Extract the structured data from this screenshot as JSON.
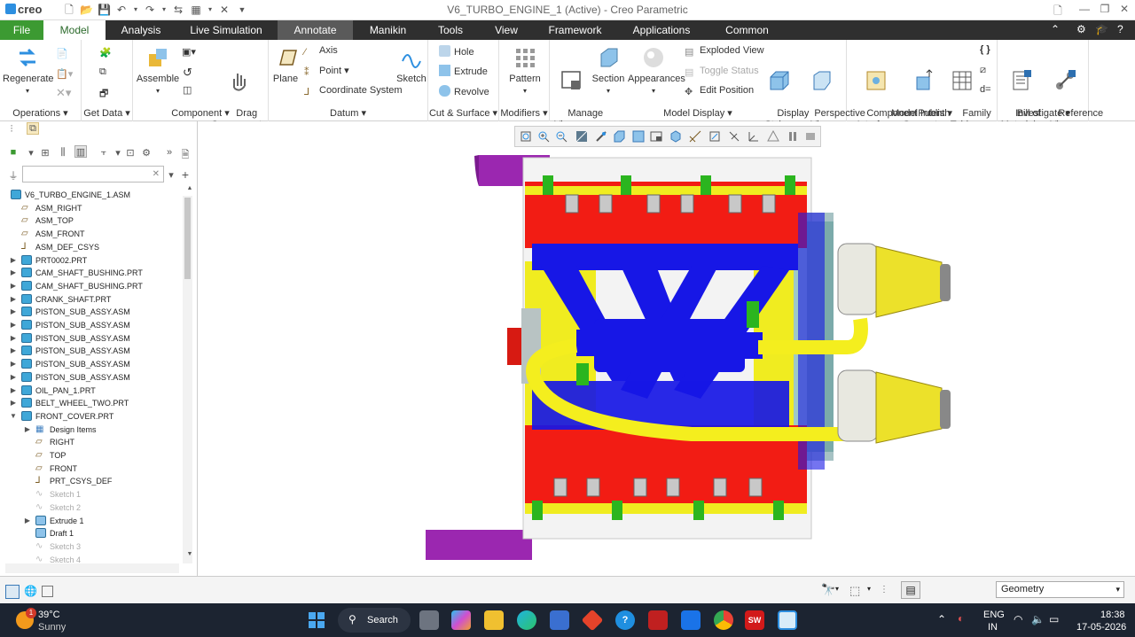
{
  "app": {
    "logo": "creo",
    "title": "V6_TURBO_ENGINE_1 (Active) - Creo Parametric"
  },
  "tabs": [
    "File",
    "Model",
    "Analysis",
    "Live Simulation",
    "Annotate",
    "Manikin",
    "Tools",
    "View",
    "Framework",
    "Applications",
    "Common"
  ],
  "ribbon": {
    "operations": {
      "regenerate": "Regenerate",
      "label": "Operations"
    },
    "get_data": {
      "label": "Get Data"
    },
    "component": {
      "assemble": "Assemble",
      "drag": "Drag\nComponents",
      "label": "Component"
    },
    "datum": {
      "plane": "Plane",
      "axis": "Axis",
      "point": "Point",
      "csys": "Coordinate System",
      "sketch": "Sketch",
      "label": "Datum"
    },
    "cut_surface": {
      "hole": "Hole",
      "extrude": "Extrude",
      "revolve": "Revolve",
      "label": "Cut & Surface"
    },
    "modifiers": {
      "pattern": "Pattern",
      "label": "Modifiers"
    },
    "model_display": {
      "manage_views": "Manage\nViews",
      "section": "Section",
      "appearances": "Appearances",
      "exploded": "Exploded View",
      "toggle": "Toggle Status",
      "edit_position": "Edit Position",
      "display_style": "Display\nStyle",
      "perspective": "Perspective\nView",
      "label": "Model Display"
    },
    "model_intent": {
      "component_interface": "Component\nInterface",
      "publish": "Publish\nGeometry",
      "family": "Family\nTable",
      "label": "Model Intent"
    },
    "investigate": {
      "bom": "Bill of\nMaterials",
      "reference": "Reference\nViewer",
      "label": "Investigate"
    }
  },
  "tree": [
    {
      "label": "V6_TURBO_ENGINE_1.ASM",
      "level": 0,
      "icon": "asm",
      "toggle": ""
    },
    {
      "label": "ASM_RIGHT",
      "level": 1,
      "icon": "plane",
      "toggle": ""
    },
    {
      "label": "ASM_TOP",
      "level": 1,
      "icon": "plane",
      "toggle": ""
    },
    {
      "label": "ASM_FRONT",
      "level": 1,
      "icon": "plane",
      "toggle": ""
    },
    {
      "label": "ASM_DEF_CSYS",
      "level": 1,
      "icon": "csys",
      "toggle": ""
    },
    {
      "label": "PRT0002.PRT",
      "level": 1,
      "icon": "part",
      "toggle": "▶"
    },
    {
      "label": "CAM_SHAFT_BUSHING.PRT",
      "level": 1,
      "icon": "part",
      "toggle": "▶"
    },
    {
      "label": "CAM_SHAFT_BUSHING.PRT",
      "level": 1,
      "icon": "part",
      "toggle": "▶"
    },
    {
      "label": "CRANK_SHAFT.PRT",
      "level": 1,
      "icon": "part",
      "toggle": "▶"
    },
    {
      "label": "PISTON_SUB_ASSY.ASM",
      "level": 1,
      "icon": "asm",
      "toggle": "▶"
    },
    {
      "label": "PISTON_SUB_ASSY.ASM",
      "level": 1,
      "icon": "asm",
      "toggle": "▶"
    },
    {
      "label": "PISTON_SUB_ASSY.ASM",
      "level": 1,
      "icon": "asm",
      "toggle": "▶"
    },
    {
      "label": "PISTON_SUB_ASSY.ASM",
      "level": 1,
      "icon": "asm",
      "toggle": "▶"
    },
    {
      "label": "PISTON_SUB_ASSY.ASM",
      "level": 1,
      "icon": "asm",
      "toggle": "▶"
    },
    {
      "label": "PISTON_SUB_ASSY.ASM",
      "level": 1,
      "icon": "asm",
      "toggle": "▶"
    },
    {
      "label": "OIL_PAN_1.PRT",
      "level": 1,
      "icon": "part",
      "toggle": "▶"
    },
    {
      "label": "BELT_WHEEL_TWO.PRT",
      "level": 1,
      "icon": "part",
      "toggle": "▶"
    },
    {
      "label": "FRONT_COVER.PRT",
      "level": 1,
      "icon": "part",
      "toggle": "▼"
    },
    {
      "label": "Design Items",
      "level": 2,
      "icon": "table",
      "toggle": "▶"
    },
    {
      "label": "RIGHT",
      "level": 2,
      "icon": "plane",
      "toggle": ""
    },
    {
      "label": "TOP",
      "level": 2,
      "icon": "plane",
      "toggle": ""
    },
    {
      "label": "FRONT",
      "level": 2,
      "icon": "plane",
      "toggle": ""
    },
    {
      "label": "PRT_CSYS_DEF",
      "level": 2,
      "icon": "csys",
      "toggle": ""
    },
    {
      "label": "Sketch 1",
      "level": 2,
      "icon": "sketch",
      "toggle": "",
      "grey": true
    },
    {
      "label": "Sketch 2",
      "level": 2,
      "icon": "sketch",
      "toggle": "",
      "grey": true
    },
    {
      "label": "Extrude 1",
      "level": 2,
      "icon": "extrude",
      "toggle": "▶"
    },
    {
      "label": "Draft 1",
      "level": 2,
      "icon": "draft",
      "toggle": ""
    },
    {
      "label": "Sketch 3",
      "level": 2,
      "icon": "sketch",
      "toggle": "",
      "grey": true
    },
    {
      "label": "Sketch 4",
      "level": 2,
      "icon": "sketch",
      "toggle": "",
      "grey": true
    }
  ],
  "status": {
    "filter": "Geometry"
  },
  "taskbar": {
    "temp": "39°C",
    "weather": "Sunny",
    "search": "Search",
    "lang1": "ENG",
    "lang2": "IN",
    "time": "18:38",
    "date": "17-05-2026",
    "badge": "1"
  },
  "colors": {
    "file_tab": "#3c9a32",
    "tabbar": "#2f2f2f",
    "taskbar": "#1c2431",
    "accent": "#2d8fe0"
  }
}
